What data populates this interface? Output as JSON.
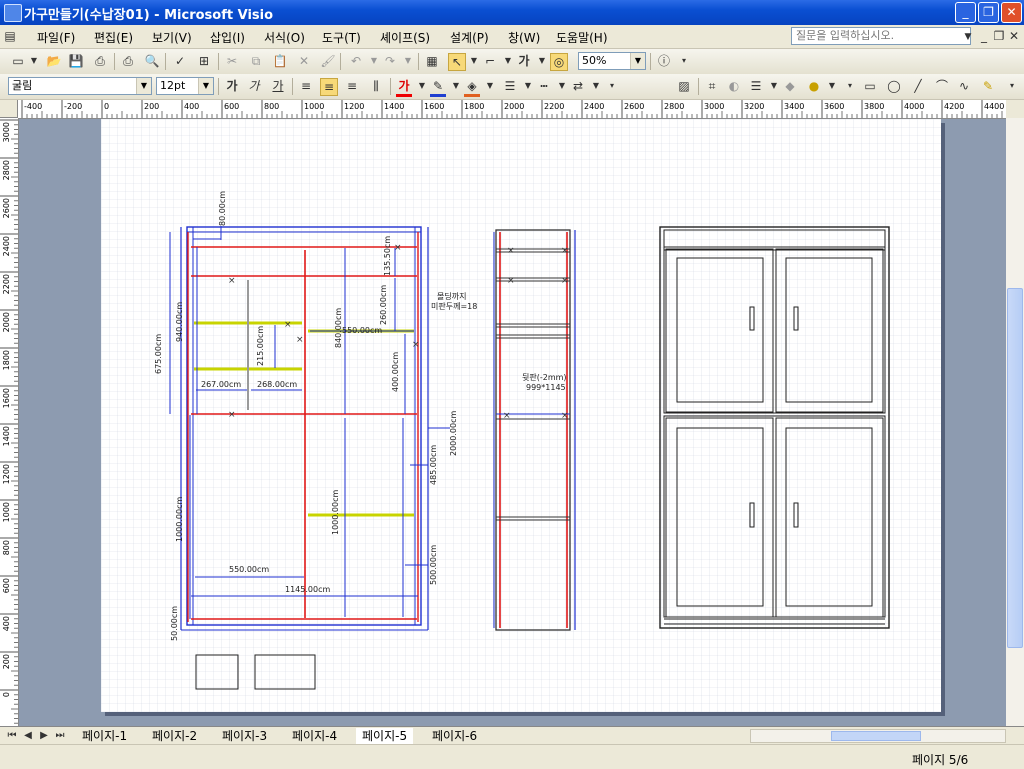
{
  "window": {
    "title": "가구만들기(수납장01) - Microsoft Visio",
    "minimize_glyph": "_",
    "maximize_glyph": "❐",
    "close_glyph": "✕"
  },
  "menu": {
    "items": [
      "파일(F)",
      "편집(E)",
      "보기(V)",
      "삽입(I)",
      "서식(O)",
      "도구(T)",
      "셰이프(S)",
      "설계(P)",
      "창(W)",
      "도움말(H)"
    ],
    "help_placeholder": "질문을 입력하십시오."
  },
  "toolbar1": {
    "zoom": "50%",
    "text_tool_label": "가"
  },
  "toolbar2": {
    "font": "굴림",
    "font_size": "12pt",
    "bold": "가",
    "italic": "가",
    "underline": "가",
    "font_color_glyph": "가"
  },
  "ruler_h": {
    "ticks": [
      "-400",
      "-200",
      "0",
      "200",
      "400",
      "600",
      "800",
      "1000",
      "1200",
      "1400",
      "1600",
      "1800",
      "2000",
      "2200",
      "2400",
      "2600",
      "2800",
      "3000",
      "3200",
      "3400",
      "3600",
      "3800",
      "4000",
      "4200",
      "4400"
    ]
  },
  "ruler_v": {
    "ticks": [
      "3000",
      "2800",
      "2600",
      "2400",
      "2200",
      "2000",
      "1800",
      "1600",
      "1400",
      "1200",
      "1000",
      "800",
      "600",
      "400",
      "200",
      "0"
    ]
  },
  "drawing": {
    "dims": {
      "d1": "80.00cm",
      "d2": "135.50cm",
      "d3": "260.00cm",
      "d4": "550.00cm",
      "d5": "940.00cm",
      "d6": "840.00cm",
      "d7": "675.00cm",
      "d8": "215.00cm",
      "d9": "400.00cm",
      "d10": "267.00cm",
      "d11": "268.00cm",
      "d12": "2000.00cm",
      "d13": "485.00cm",
      "d14": "1000.00cm",
      "d15": "1000.00cm",
      "d16": "550.00cm",
      "d17": "500.00cm",
      "d18": "1145.00cm",
      "d19": "50.00cm"
    },
    "note1_line1": "몰딩까지",
    "note1_line2": "미판두께=18",
    "note2_line1": "뒷판(-2mm)",
    "note2_line2": "999*1145"
  },
  "tabs": [
    "페이지-1",
    "페이지-2",
    "페이지-3",
    "페이지-4",
    "페이지-5",
    "페이지-6"
  ],
  "active_tab": "페이지-5",
  "status": {
    "page": "페이지 5/6"
  }
}
